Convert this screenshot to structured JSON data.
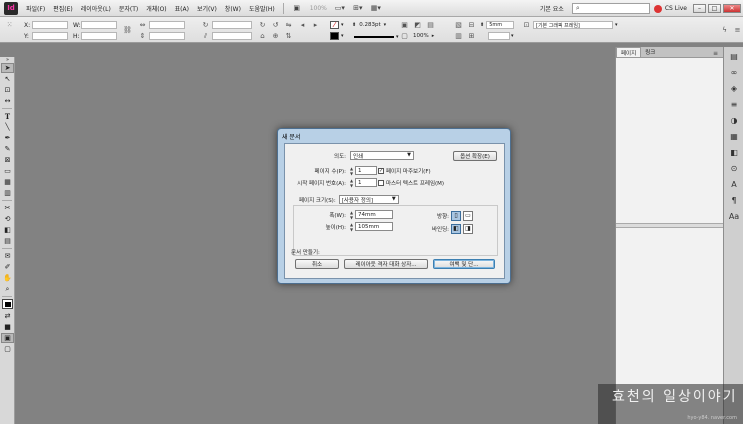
{
  "menubar": {
    "app_logo": "Id",
    "items": [
      "파일(F)",
      "편집(E)",
      "레이아웃(L)",
      "문자(T)",
      "개체(O)",
      "표(A)",
      "보기(V)",
      "창(W)",
      "도움말(H)"
    ],
    "zoom": "100%",
    "workspace": "기본 요소",
    "cs_live": "CS Live",
    "window_buttons": [
      "–",
      "□",
      "✕"
    ]
  },
  "controlbar": {
    "x_label": "X:",
    "y_label": "Y:",
    "w_label": "W:",
    "h_label": "H:",
    "stroke_weight": "0.283pt",
    "zoom_percent": "100%",
    "gap_value": "5mm",
    "frame_style": "[기본 그래픽 프레임]"
  },
  "panels": {
    "tabs": [
      "페이지",
      "링크"
    ],
    "menu_icon": "≡"
  },
  "dialog": {
    "title": "새 문서",
    "intent_label": "의도:",
    "intent_value": "인쇄",
    "more_options_label": "옵션 확장(E)",
    "pages_label": "페이지 수(P):",
    "pages_value": "1",
    "facing_pages_label": "페이지 마주보기(F)",
    "facing_pages_checked": true,
    "start_page_label": "시작 페이지 번호(A):",
    "start_page_value": "1",
    "master_text_label": "마스터 텍스트 프레임(M)",
    "master_text_checked": false,
    "page_size_label": "페이지 크기(S):",
    "page_size_value": "[사용자 정의]",
    "width_label": "폭(W):",
    "width_value": "74mm",
    "height_label": "높이(H):",
    "height_value": "105mm",
    "orientation_label": "방향:",
    "binding_label": "바인딩:",
    "create_label": "문서 만들기:",
    "cancel_label": "취소",
    "layout_grid_label": "레이아웃 격자 대화 상자...",
    "margins_label": "여백 및 단..."
  },
  "watermark": {
    "title": "효천의 일상이야기",
    "sub": "hyo-y84. naver.com"
  }
}
